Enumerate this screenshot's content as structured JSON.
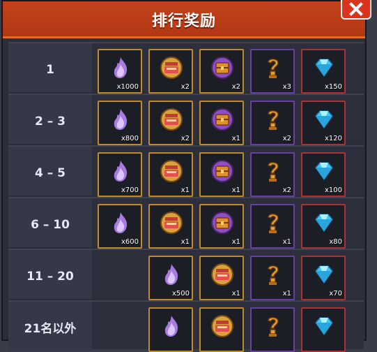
{
  "header": {
    "title": "排行奖励"
  },
  "close_icon": "close-icon",
  "colors": {
    "header": "#b23814",
    "gold_border": "#c08a2a",
    "purple_border": "#6a3fa3",
    "red_border": "#a83234"
  },
  "rows": [
    {
      "rank": "1",
      "rewards": [
        {
          "item": "soul-flame-icon",
          "qty": "x1000"
        },
        {
          "item": "treasure-pot-icon",
          "qty": "x2"
        },
        {
          "item": "treasure-chest-icon",
          "qty": "x2"
        },
        {
          "item": "mystery-key-icon",
          "qty": "x3"
        },
        {
          "item": "gem-icon",
          "qty": "x150"
        }
      ]
    },
    {
      "rank": "2 – 3",
      "rewards": [
        {
          "item": "soul-flame-icon",
          "qty": "x800"
        },
        {
          "item": "treasure-pot-icon",
          "qty": "x2"
        },
        {
          "item": "treasure-chest-icon",
          "qty": "x1"
        },
        {
          "item": "mystery-key-icon",
          "qty": "x2"
        },
        {
          "item": "gem-icon",
          "qty": "x120"
        }
      ]
    },
    {
      "rank": "4 – 5",
      "rewards": [
        {
          "item": "soul-flame-icon",
          "qty": "x700"
        },
        {
          "item": "treasure-pot-icon",
          "qty": "x1"
        },
        {
          "item": "treasure-chest-icon",
          "qty": "x1"
        },
        {
          "item": "mystery-key-icon",
          "qty": "x2"
        },
        {
          "item": "gem-icon",
          "qty": "x100"
        }
      ]
    },
    {
      "rank": "6 – 10",
      "rewards": [
        {
          "item": "soul-flame-icon",
          "qty": "x600"
        },
        {
          "item": "treasure-pot-icon",
          "qty": "x1"
        },
        {
          "item": "treasure-chest-icon",
          "qty": "x1"
        },
        {
          "item": "mystery-key-icon",
          "qty": "x1"
        },
        {
          "item": "gem-icon",
          "qty": "x80"
        }
      ]
    },
    {
      "rank": "11 – 20",
      "rewards": [
        {
          "item": "soul-flame-icon",
          "qty": "x500"
        },
        {
          "item": "treasure-pot-icon",
          "qty": "x1"
        },
        {
          "item": "mystery-key-icon",
          "qty": "x1"
        },
        {
          "item": "gem-icon",
          "qty": "x70"
        }
      ]
    },
    {
      "rank": "21名以外",
      "rewards": [
        {
          "item": "soul-flame-icon",
          "qty": ""
        },
        {
          "item": "treasure-pot-icon",
          "qty": ""
        },
        {
          "item": "mystery-key-icon",
          "qty": ""
        },
        {
          "item": "gem-icon",
          "qty": ""
        }
      ]
    }
  ]
}
